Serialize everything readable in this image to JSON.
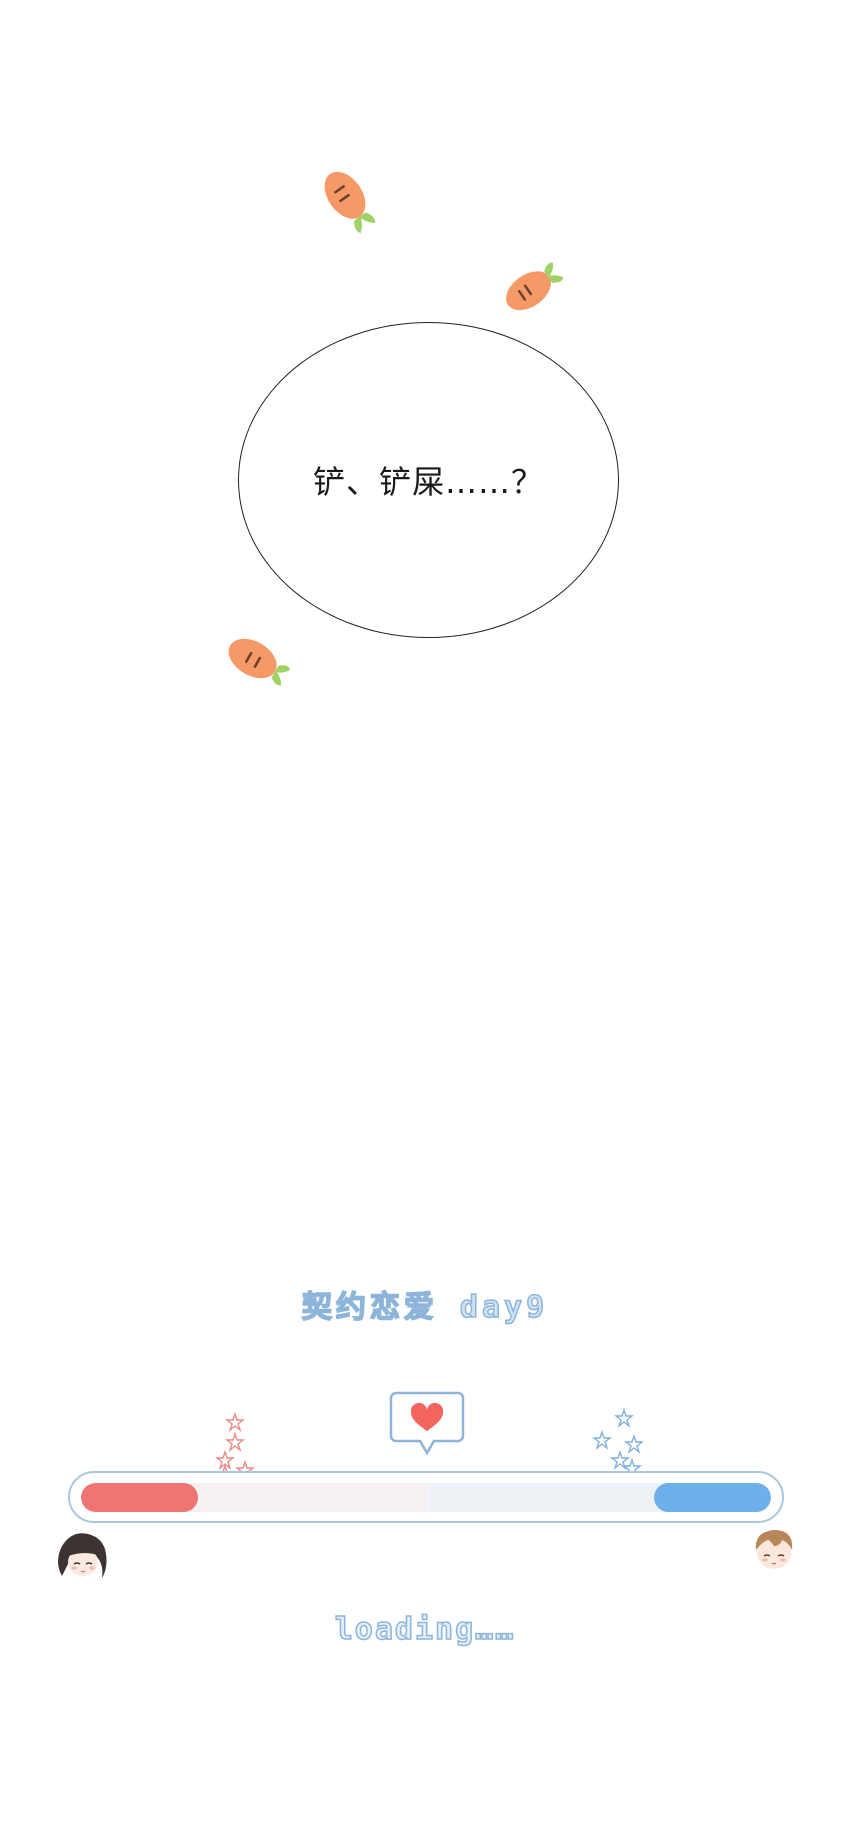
{
  "bubble": {
    "text": "铲、铲屎……？"
  },
  "chapter": {
    "title": "契约恋爱 day9"
  },
  "progress": {
    "left_value": 0.17,
    "right_value": 0.17,
    "left_color": "#ef7570",
    "right_color": "#6eb0ec"
  },
  "status": {
    "text": "loading……"
  },
  "icons": [
    "carrot-icon",
    "heart-icon",
    "star-icon",
    "girl-avatar",
    "boy-avatar"
  ]
}
